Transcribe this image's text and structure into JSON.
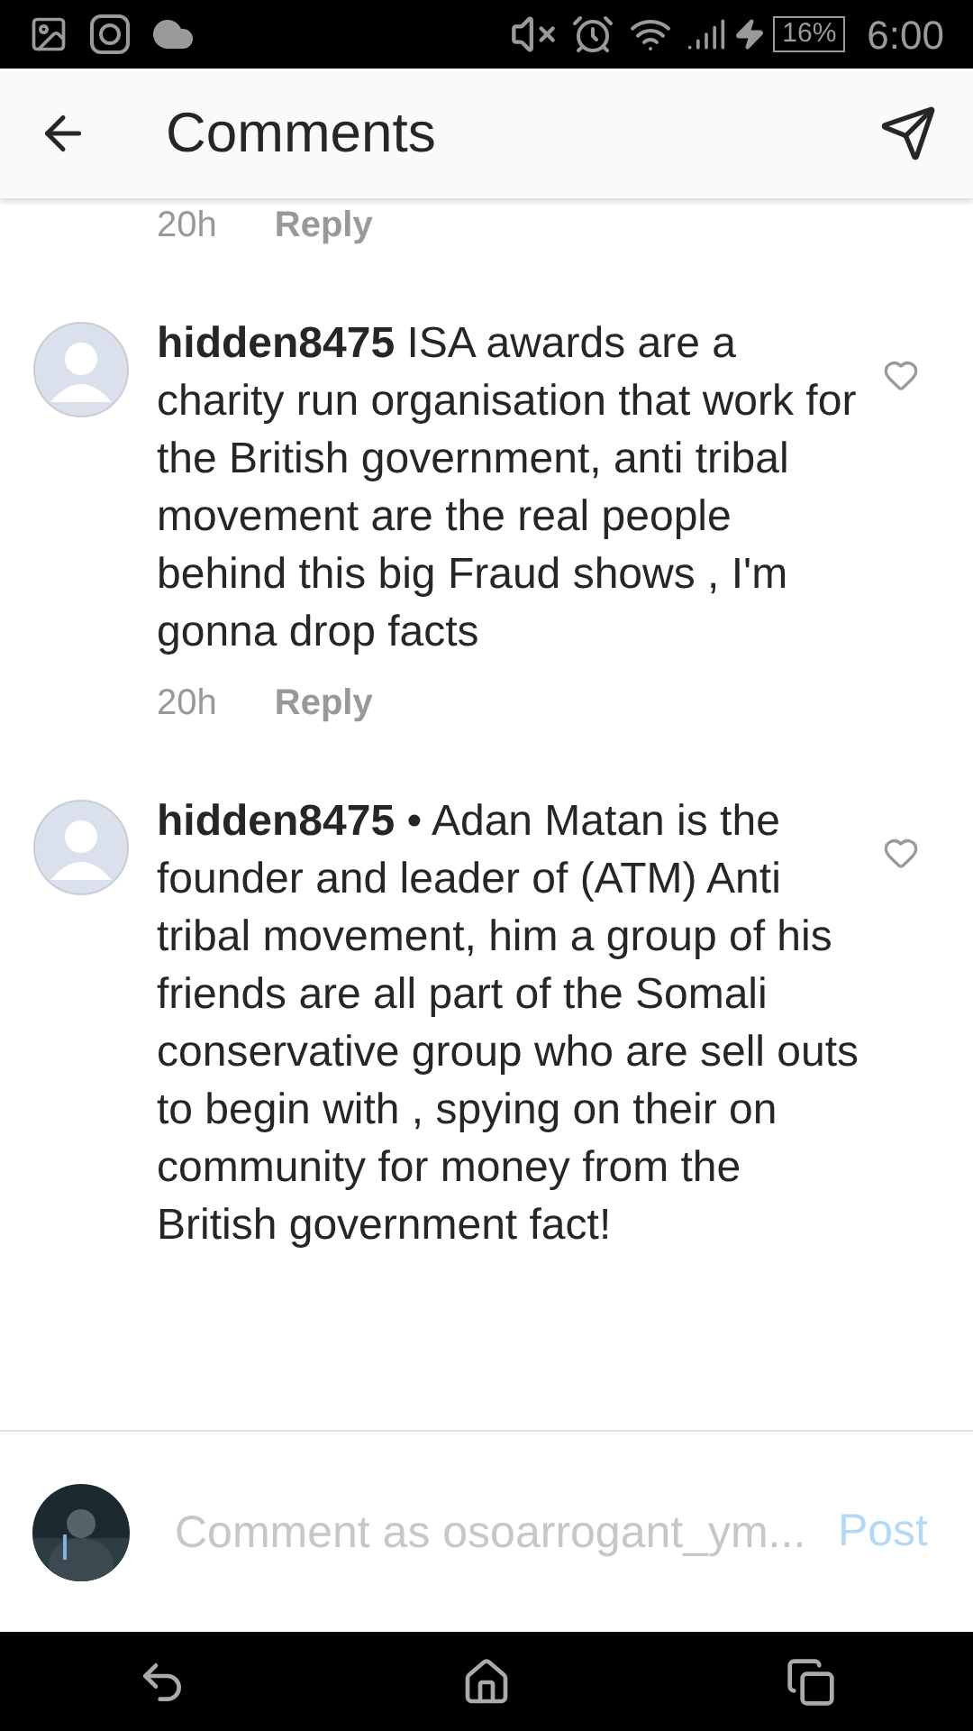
{
  "status_bar": {
    "battery": "16%",
    "time": "6:00"
  },
  "header": {
    "title": "Comments"
  },
  "previous_comment_footer": {
    "time": "20h",
    "reply": "Reply"
  },
  "comments": [
    {
      "username": "hidden8475",
      "text": "ISA awards are a charity run organisation that work for the  British government, anti tribal movement are the real people behind this big Fraud shows , I'm gonna drop facts",
      "time": "20h",
      "reply": "Reply",
      "liked": false
    },
    {
      "username": "hidden8475",
      "text": "• Adan Matan is the founder and leader of (ATM) Anti tribal movement, him a group of his friends are all part of the Somali conservative group who are sell outs to begin with , spying on their on community for money from the British government fact!",
      "liked": false
    }
  ],
  "composer": {
    "placeholder": "Comment as osoarrogant_ym...",
    "post": "Post"
  }
}
